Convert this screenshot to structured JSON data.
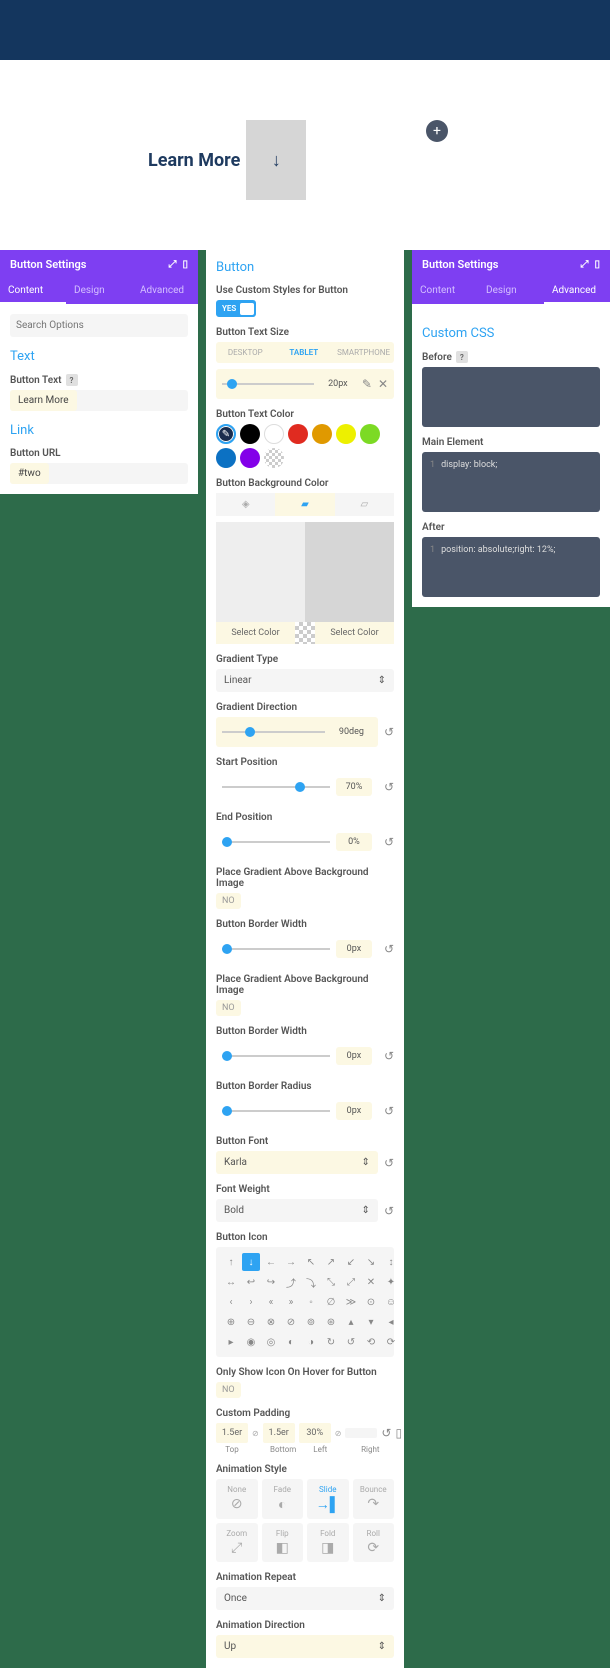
{
  "preview": {
    "button_text": "Learn More"
  },
  "panel1": {
    "title": "Button Settings",
    "tabs": {
      "content": "Content",
      "design": "Design",
      "advanced": "Advanced"
    },
    "search_placeholder": "Search Options",
    "sections": {
      "text": "Text",
      "button_text_label": "Button Text",
      "button_text_value": "Learn More",
      "link": "Link",
      "button_url_label": "Button URL",
      "button_url_value": "#two"
    }
  },
  "panel2": {
    "title": "Button",
    "use_custom_label": "Use Custom Styles for Button",
    "yes": "YES",
    "text_size_label": "Button Text Size",
    "devices": {
      "desktop": "DESKTOP",
      "tablet": "TABLET",
      "smartphone": "SMARTPHONE"
    },
    "text_size_value": "20px",
    "text_color_label": "Button Text Color",
    "bg_color_label": "Button Background Color",
    "select_color": "Select Color",
    "gradient_type_label": "Gradient Type",
    "gradient_type_value": "Linear",
    "gradient_direction_label": "Gradient Direction",
    "gradient_direction_value": "90deg",
    "start_position_label": "Start Position",
    "start_position_value": "70%",
    "end_position_label": "End Position",
    "end_position_value": "0%",
    "place_gradient_label": "Place Gradient Above Background Image",
    "no": "NO",
    "border_width_label": "Button Border Width",
    "border_width_value": "0px",
    "border_radius_label": "Button Border Radius",
    "border_radius_value": "0px",
    "font_label": "Button Font",
    "font_value": "Karla",
    "font_weight_label": "Font Weight",
    "font_weight_value": "Bold",
    "icon_label": "Button Icon",
    "only_show_hover_label": "Only Show Icon On Hover for Button",
    "custom_padding_label": "Custom Padding",
    "padding": {
      "top": "1.5er",
      "bottom": "1.5er",
      "left": "30%",
      "right": ""
    },
    "padding_labels": {
      "top": "Top",
      "bottom": "Bottom",
      "left": "Left",
      "right": "Right"
    },
    "anim_style_label": "Animation Style",
    "anim_styles": {
      "none": "None",
      "fade": "Fade",
      "slide": "Slide",
      "bounce": "Bounce",
      "zoom": "Zoom",
      "flip": "Flip",
      "fold": "Fold",
      "roll": "Roll"
    },
    "anim_repeat_label": "Animation Repeat",
    "anim_repeat_value": "Once",
    "anim_direction_label": "Animation Direction",
    "anim_direction_value": "Up"
  },
  "panel3": {
    "title": "Button Settings",
    "tabs": {
      "content": "Content",
      "design": "Design",
      "advanced": "Advanced"
    },
    "css_title": "Custom CSS",
    "before_label": "Before",
    "main_label": "Main Element",
    "main_code": "display: block;",
    "after_label": "After",
    "after_code": "position: absolute;right: 12%;"
  }
}
